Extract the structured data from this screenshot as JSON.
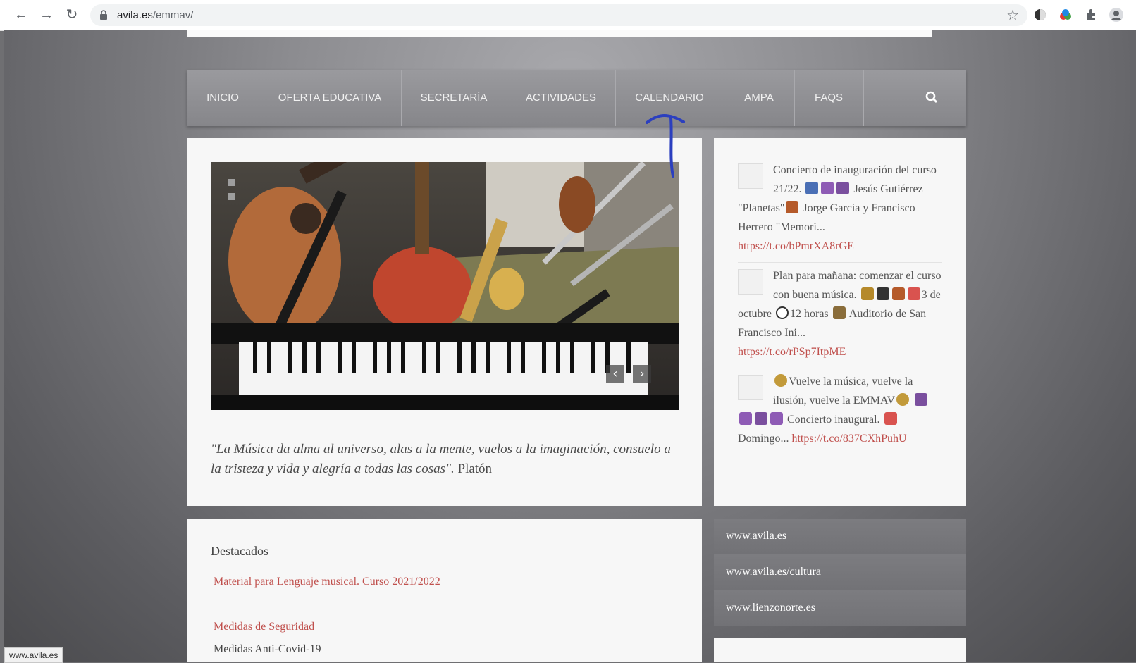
{
  "browser": {
    "url_host": "avila.es",
    "url_path": "/emmav/",
    "status_url": "www.avila.es"
  },
  "nav": {
    "items": [
      "INICIO",
      "OFERTA EDUCATIVA",
      "SECRETARÍA",
      "ACTIVIDADES",
      "CALENDARIO",
      "AMPA",
      "FAQS"
    ]
  },
  "slider": {
    "quote_italic": "\"La Música da alma al universo, alas a la mente, vuelos a la imaginación, consuelo a la tristeza y vida y alegría a todas las cosas\".",
    "quote_author": " Platón"
  },
  "tweets": [
    {
      "text_a": "Concierto de inauguración del curso 21/22. ",
      "text_b": " Jesús Gutiérrez \"Planetas\"",
      "text_c": " Jorge García y Francisco Herrero \"Memori...",
      "link": "https://t.co/bPmrXA8rGE"
    },
    {
      "text_a": "Plan para mañana: comenzar el curso con buena música. ",
      "text_b": "3 de octubre ",
      "text_c": "12 horas ",
      "text_d": "Auditorio de San Francisco Ini...",
      "link": "https://t.co/rPSp7ItpME"
    },
    {
      "text_a": "Vuelve la música, vuelve la ilusión, vuelve la EMMAV",
      "text_b": " Concierto inaugural. ",
      "text_c": "Domingo... ",
      "link": "https://t.co/837CXhPuhU"
    }
  ],
  "links": [
    "www.avila.es",
    "www.avila.es/cultura",
    "www.lienzonorte.es"
  ],
  "destacados": {
    "title": "Destacados",
    "item1": "Material para Lenguaje musical. Curso 2021/2022",
    "item2": "Medidas de Seguridad",
    "item2_sub": "Medidas Anti-Covid-19"
  },
  "colors": {
    "link": "#c0504d",
    "nav_bg": "#919195",
    "annotation": "#2b3fbf"
  }
}
